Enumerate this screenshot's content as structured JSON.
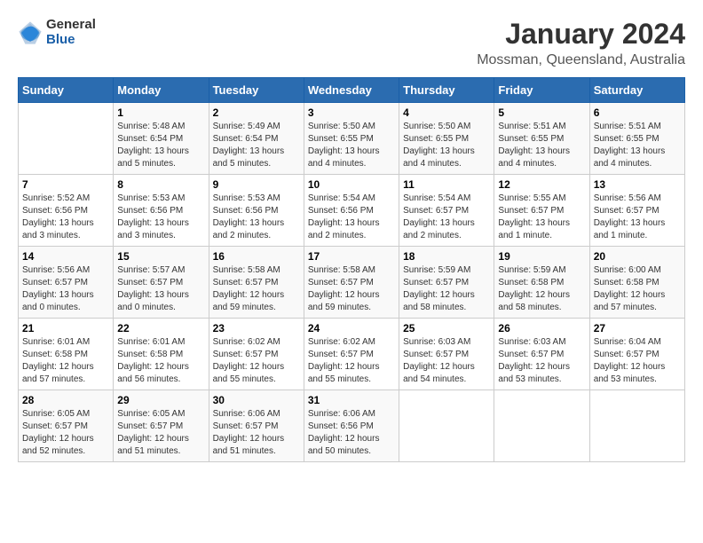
{
  "logo": {
    "general": "General",
    "blue": "Blue"
  },
  "title": "January 2024",
  "subtitle": "Mossman, Queensland, Australia",
  "days_of_week": [
    "Sunday",
    "Monday",
    "Tuesday",
    "Wednesday",
    "Thursday",
    "Friday",
    "Saturday"
  ],
  "weeks": [
    [
      {
        "day": "",
        "sunrise": "",
        "sunset": "",
        "daylight": ""
      },
      {
        "day": "1",
        "sunrise": "Sunrise: 5:48 AM",
        "sunset": "Sunset: 6:54 PM",
        "daylight": "Daylight: 13 hours and 5 minutes."
      },
      {
        "day": "2",
        "sunrise": "Sunrise: 5:49 AM",
        "sunset": "Sunset: 6:54 PM",
        "daylight": "Daylight: 13 hours and 5 minutes."
      },
      {
        "day": "3",
        "sunrise": "Sunrise: 5:50 AM",
        "sunset": "Sunset: 6:55 PM",
        "daylight": "Daylight: 13 hours and 4 minutes."
      },
      {
        "day": "4",
        "sunrise": "Sunrise: 5:50 AM",
        "sunset": "Sunset: 6:55 PM",
        "daylight": "Daylight: 13 hours and 4 minutes."
      },
      {
        "day": "5",
        "sunrise": "Sunrise: 5:51 AM",
        "sunset": "Sunset: 6:55 PM",
        "daylight": "Daylight: 13 hours and 4 minutes."
      },
      {
        "day": "6",
        "sunrise": "Sunrise: 5:51 AM",
        "sunset": "Sunset: 6:55 PM",
        "daylight": "Daylight: 13 hours and 4 minutes."
      }
    ],
    [
      {
        "day": "7",
        "sunrise": "Sunrise: 5:52 AM",
        "sunset": "Sunset: 6:56 PM",
        "daylight": "Daylight: 13 hours and 3 minutes."
      },
      {
        "day": "8",
        "sunrise": "Sunrise: 5:53 AM",
        "sunset": "Sunset: 6:56 PM",
        "daylight": "Daylight: 13 hours and 3 minutes."
      },
      {
        "day": "9",
        "sunrise": "Sunrise: 5:53 AM",
        "sunset": "Sunset: 6:56 PM",
        "daylight": "Daylight: 13 hours and 2 minutes."
      },
      {
        "day": "10",
        "sunrise": "Sunrise: 5:54 AM",
        "sunset": "Sunset: 6:56 PM",
        "daylight": "Daylight: 13 hours and 2 minutes."
      },
      {
        "day": "11",
        "sunrise": "Sunrise: 5:54 AM",
        "sunset": "Sunset: 6:57 PM",
        "daylight": "Daylight: 13 hours and 2 minutes."
      },
      {
        "day": "12",
        "sunrise": "Sunrise: 5:55 AM",
        "sunset": "Sunset: 6:57 PM",
        "daylight": "Daylight: 13 hours and 1 minute."
      },
      {
        "day": "13",
        "sunrise": "Sunrise: 5:56 AM",
        "sunset": "Sunset: 6:57 PM",
        "daylight": "Daylight: 13 hours and 1 minute."
      }
    ],
    [
      {
        "day": "14",
        "sunrise": "Sunrise: 5:56 AM",
        "sunset": "Sunset: 6:57 PM",
        "daylight": "Daylight: 13 hours and 0 minutes."
      },
      {
        "day": "15",
        "sunrise": "Sunrise: 5:57 AM",
        "sunset": "Sunset: 6:57 PM",
        "daylight": "Daylight: 13 hours and 0 minutes."
      },
      {
        "day": "16",
        "sunrise": "Sunrise: 5:58 AM",
        "sunset": "Sunset: 6:57 PM",
        "daylight": "Daylight: 12 hours and 59 minutes."
      },
      {
        "day": "17",
        "sunrise": "Sunrise: 5:58 AM",
        "sunset": "Sunset: 6:57 PM",
        "daylight": "Daylight: 12 hours and 59 minutes."
      },
      {
        "day": "18",
        "sunrise": "Sunrise: 5:59 AM",
        "sunset": "Sunset: 6:57 PM",
        "daylight": "Daylight: 12 hours and 58 minutes."
      },
      {
        "day": "19",
        "sunrise": "Sunrise: 5:59 AM",
        "sunset": "Sunset: 6:58 PM",
        "daylight": "Daylight: 12 hours and 58 minutes."
      },
      {
        "day": "20",
        "sunrise": "Sunrise: 6:00 AM",
        "sunset": "Sunset: 6:58 PM",
        "daylight": "Daylight: 12 hours and 57 minutes."
      }
    ],
    [
      {
        "day": "21",
        "sunrise": "Sunrise: 6:01 AM",
        "sunset": "Sunset: 6:58 PM",
        "daylight": "Daylight: 12 hours and 57 minutes."
      },
      {
        "day": "22",
        "sunrise": "Sunrise: 6:01 AM",
        "sunset": "Sunset: 6:58 PM",
        "daylight": "Daylight: 12 hours and 56 minutes."
      },
      {
        "day": "23",
        "sunrise": "Sunrise: 6:02 AM",
        "sunset": "Sunset: 6:57 PM",
        "daylight": "Daylight: 12 hours and 55 minutes."
      },
      {
        "day": "24",
        "sunrise": "Sunrise: 6:02 AM",
        "sunset": "Sunset: 6:57 PM",
        "daylight": "Daylight: 12 hours and 55 minutes."
      },
      {
        "day": "25",
        "sunrise": "Sunrise: 6:03 AM",
        "sunset": "Sunset: 6:57 PM",
        "daylight": "Daylight: 12 hours and 54 minutes."
      },
      {
        "day": "26",
        "sunrise": "Sunrise: 6:03 AM",
        "sunset": "Sunset: 6:57 PM",
        "daylight": "Daylight: 12 hours and 53 minutes."
      },
      {
        "day": "27",
        "sunrise": "Sunrise: 6:04 AM",
        "sunset": "Sunset: 6:57 PM",
        "daylight": "Daylight: 12 hours and 53 minutes."
      }
    ],
    [
      {
        "day": "28",
        "sunrise": "Sunrise: 6:05 AM",
        "sunset": "Sunset: 6:57 PM",
        "daylight": "Daylight: 12 hours and 52 minutes."
      },
      {
        "day": "29",
        "sunrise": "Sunrise: 6:05 AM",
        "sunset": "Sunset: 6:57 PM",
        "daylight": "Daylight: 12 hours and 51 minutes."
      },
      {
        "day": "30",
        "sunrise": "Sunrise: 6:06 AM",
        "sunset": "Sunset: 6:57 PM",
        "daylight": "Daylight: 12 hours and 51 minutes."
      },
      {
        "day": "31",
        "sunrise": "Sunrise: 6:06 AM",
        "sunset": "Sunset: 6:56 PM",
        "daylight": "Daylight: 12 hours and 50 minutes."
      },
      {
        "day": "",
        "sunrise": "",
        "sunset": "",
        "daylight": ""
      },
      {
        "day": "",
        "sunrise": "",
        "sunset": "",
        "daylight": ""
      },
      {
        "day": "",
        "sunrise": "",
        "sunset": "",
        "daylight": ""
      }
    ]
  ]
}
